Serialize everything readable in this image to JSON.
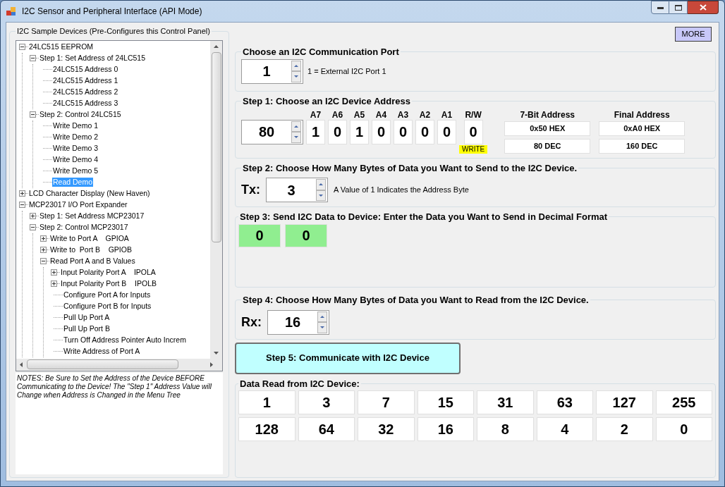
{
  "window": {
    "title": "I2C Sensor and Peripheral Interface (API Mode)"
  },
  "sample_devices": {
    "title": "I2C Sample Devices (Pre-Configures this Control Panel)",
    "tree": [
      {
        "label": "24LC515 EEPROM",
        "expanded": true,
        "selected": false,
        "children": [
          {
            "label": "Step 1: Set Address of 24LC515",
            "expanded": true,
            "selected": false,
            "children": [
              {
                "label": "24LC515 Address 0",
                "selected": false
              },
              {
                "label": "24LC515 Address 1",
                "selected": false
              },
              {
                "label": "24LC515 Address 2",
                "selected": false
              },
              {
                "label": "24LC515 Address 3",
                "selected": false
              }
            ]
          },
          {
            "label": "Step 2: Control 24LC515",
            "expanded": true,
            "selected": false,
            "children": [
              {
                "label": "Write Demo 1",
                "selected": false
              },
              {
                "label": "Write Demo 2",
                "selected": false
              },
              {
                "label": "Write Demo 3",
                "selected": false
              },
              {
                "label": "Write Demo 4",
                "selected": false
              },
              {
                "label": "Write Demo 5",
                "selected": false
              },
              {
                "label": "Read Demo",
                "selected": true
              }
            ]
          }
        ]
      },
      {
        "label": "LCD Character Display (New Haven)",
        "expanded": false,
        "selected": false
      },
      {
        "label": "MCP23017 I/O Port Expander",
        "expanded": true,
        "selected": false,
        "children": [
          {
            "label": "Step 1: Set Address MCP23017",
            "expanded": false,
            "selected": false
          },
          {
            "label": "Step 2: Control MCP23017",
            "expanded": true,
            "selected": false,
            "children": [
              {
                "label": "Write to Port A    GPIOA",
                "expanded": false,
                "selected": false
              },
              {
                "label": "Write to  Port B    GPIOB",
                "expanded": false,
                "selected": false
              },
              {
                "label": "Read Port A and B Values",
                "expanded": true,
                "selected": false,
                "children": [
                  {
                    "label": "Input Polarity Port A    IPOLA",
                    "expanded": false,
                    "selected": false
                  },
                  {
                    "label": "Input Polarity Port B    IPOLB",
                    "expanded": false,
                    "selected": false
                  },
                  {
                    "label": "Configure Port A for Inputs",
                    "selected": false
                  },
                  {
                    "label": "Configure Port B for Inputs",
                    "selected": false
                  },
                  {
                    "label": "Pull Up Port A",
                    "selected": false
                  },
                  {
                    "label": "Pull Up Port B",
                    "selected": false
                  },
                  {
                    "label": "Turn Off Address Pointer Auto Increm",
                    "selected": false
                  },
                  {
                    "label": "Write Address of Port A",
                    "selected": false
                  }
                ]
              }
            ]
          }
        ]
      }
    ],
    "notes": "NOTES:  Be Sure to Set the Address of the Device BEFORE Communicating to the Device!  The \"Step 1\" Address Value will Change when Address is Changed in the Menu Tree"
  },
  "more_button": "MORE",
  "port": {
    "title": "Choose an I2C Communication Port",
    "value": "1",
    "description": "1 = External I2C Port 1"
  },
  "address": {
    "title": "Step 1: Choose an I2C Device Address",
    "value": "80",
    "bits": [
      {
        "label": "A7",
        "value": "1"
      },
      {
        "label": "A6",
        "value": "0"
      },
      {
        "label": "A5",
        "value": "1"
      },
      {
        "label": "A4",
        "value": "0"
      },
      {
        "label": "A3",
        "value": "0"
      },
      {
        "label": "A2",
        "value": "0"
      },
      {
        "label": "A1",
        "value": "0"
      },
      {
        "label": "R/W",
        "value": "0"
      }
    ],
    "rw_badge": "WRITE",
    "seven_bit": {
      "title": "7-Bit Address",
      "hex": "0x50 HEX",
      "dec": "80 DEC"
    },
    "final": {
      "title": "Final Address",
      "hex": "0xA0 HEX",
      "dec": "160 DEC"
    }
  },
  "tx": {
    "title": "Step 2:  Choose How Many Bytes of Data you Want to Send to the I2C Device.",
    "label": "Tx:",
    "value": "3",
    "hint": "A Value of 1 Indicates the Address Byte"
  },
  "send_data": {
    "title": "Step 3: Send I2C Data to Device: Enter the Data you Want to Send in Decimal Format",
    "values": [
      "0",
      "0"
    ]
  },
  "rx": {
    "title": "Step 4:  Choose How Many Bytes of Data you Want to Read from the I2C Device.",
    "label": "Rx:",
    "value": "16"
  },
  "communicate_button": "Step 5: Communicate with I2C Device",
  "read_data": {
    "title": "Data Read from I2C Device:",
    "values": [
      "1",
      "3",
      "7",
      "15",
      "31",
      "63",
      "127",
      "255",
      "128",
      "64",
      "32",
      "16",
      "8",
      "4",
      "2",
      "0"
    ]
  }
}
